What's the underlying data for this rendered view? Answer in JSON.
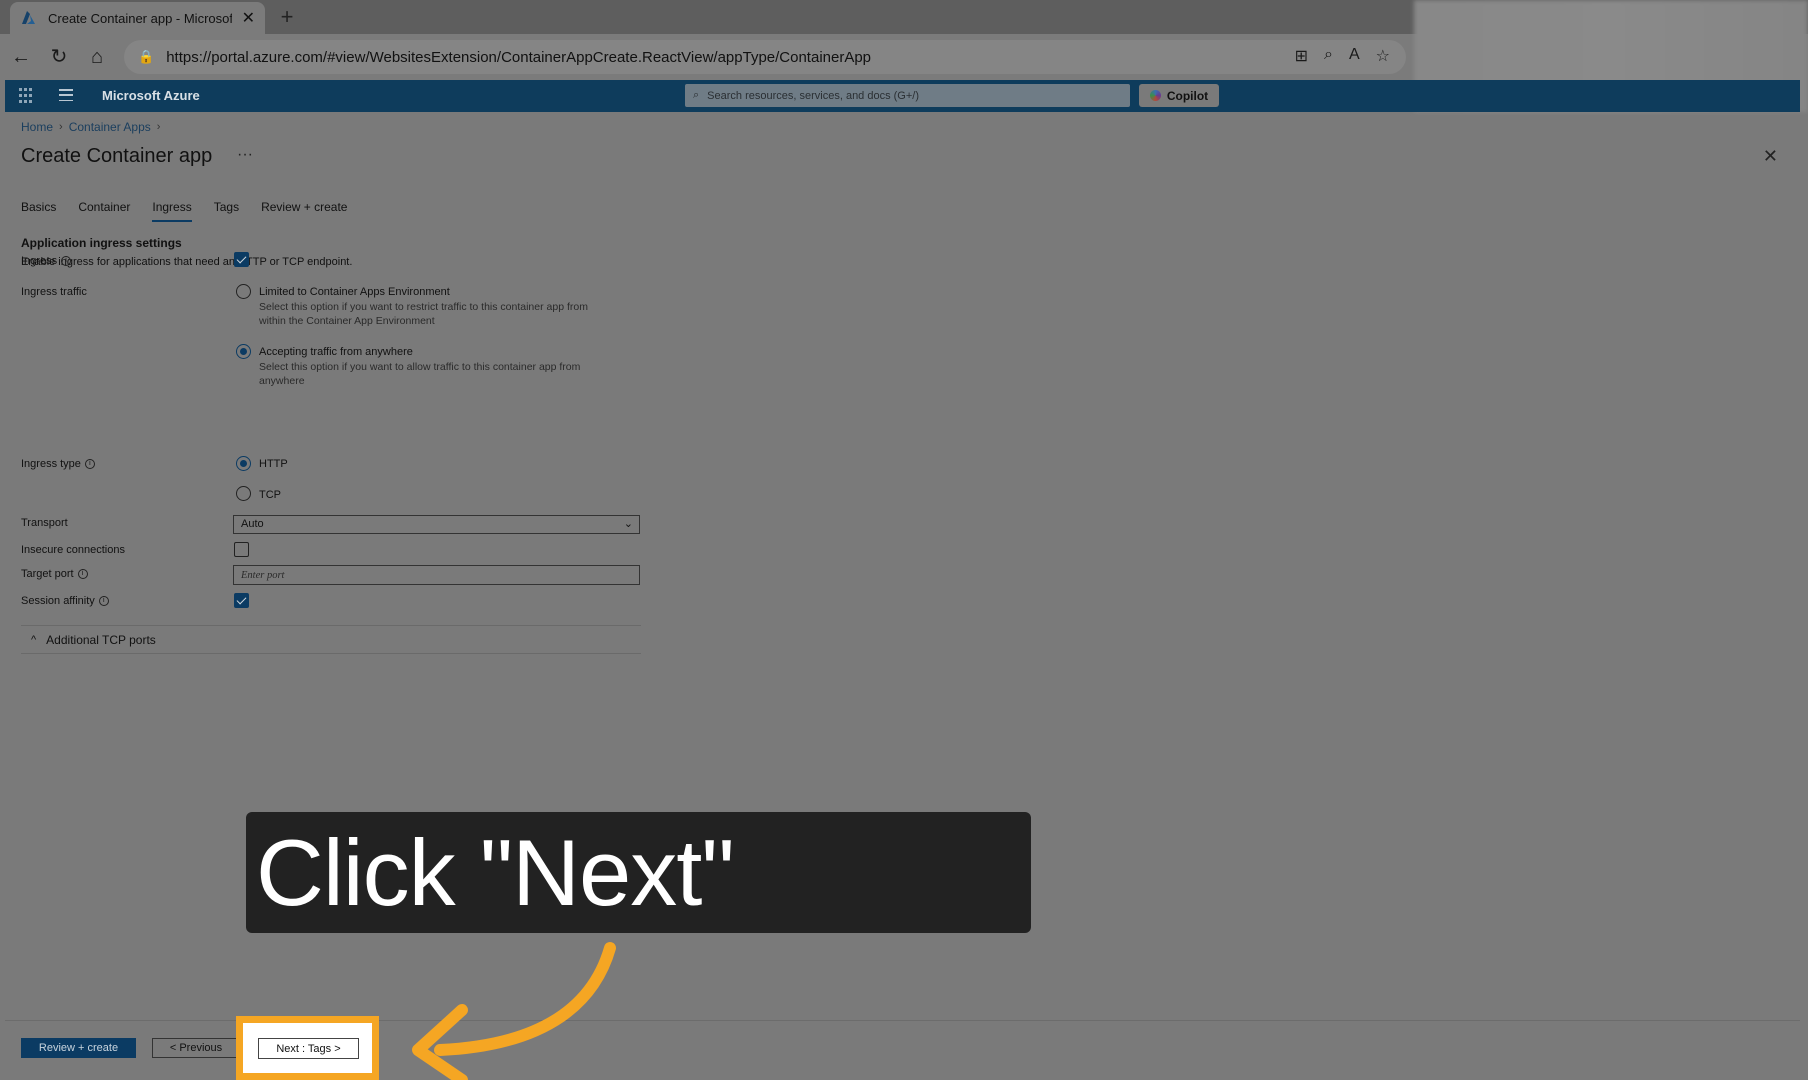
{
  "browser": {
    "tab_title": "Create Container app - Microsoft Azure",
    "url": "https://portal.azure.com/#view/WebsitesExtension/ContainerAppCreate.ReactView/appType/ContainerApp"
  },
  "azure": {
    "brand": "Microsoft Azure",
    "search_placeholder": "Search resources, services, and docs (G+/)",
    "copilot_label": "Copilot"
  },
  "breadcrumb": [
    "Home",
    "Container Apps"
  ],
  "page_title": "Create Container app",
  "tabs": [
    "Basics",
    "Container",
    "Ingress",
    "Tags",
    "Review + create"
  ],
  "active_tab": "Ingress",
  "section": {
    "title": "Application ingress settings",
    "description": "Enable ingress for applications that need an HTTP or TCP endpoint."
  },
  "form": {
    "ingress_label": "Ingress",
    "ingress_checked": true,
    "ingress_traffic_label": "Ingress traffic",
    "traffic_options": [
      {
        "label": "Limited to Container Apps Environment",
        "desc_line1": "Select this option if you want to restrict traffic to this container app from",
        "desc_line2": "within the Container App Environment",
        "selected": false
      },
      {
        "label": "Accepting traffic from anywhere",
        "desc_line1": "Select this option if you want to allow traffic to this container app from",
        "desc_line2": "anywhere",
        "selected": true
      }
    ],
    "ingress_type_label": "Ingress type",
    "type_options": [
      {
        "label": "HTTP",
        "selected": true
      },
      {
        "label": "TCP",
        "selected": false
      }
    ],
    "transport_label": "Transport",
    "transport_value": "Auto",
    "insecure_label": "Insecure connections",
    "insecure_checked": false,
    "target_port_label": "Target port",
    "target_port_placeholder": "Enter port",
    "session_affinity_label": "Session affinity",
    "session_affinity_checked": true,
    "additional_tcp_label": "Additional TCP ports"
  },
  "footer": {
    "review_label": "Review + create",
    "previous_label": "< Previous",
    "next_label": "Next : Tags >"
  },
  "callout": {
    "text": "Click \"Next\""
  },
  "colors": {
    "highlight": "#f5a623",
    "azure_bar": "#0e3c5c",
    "primary": "#0b3b63"
  }
}
